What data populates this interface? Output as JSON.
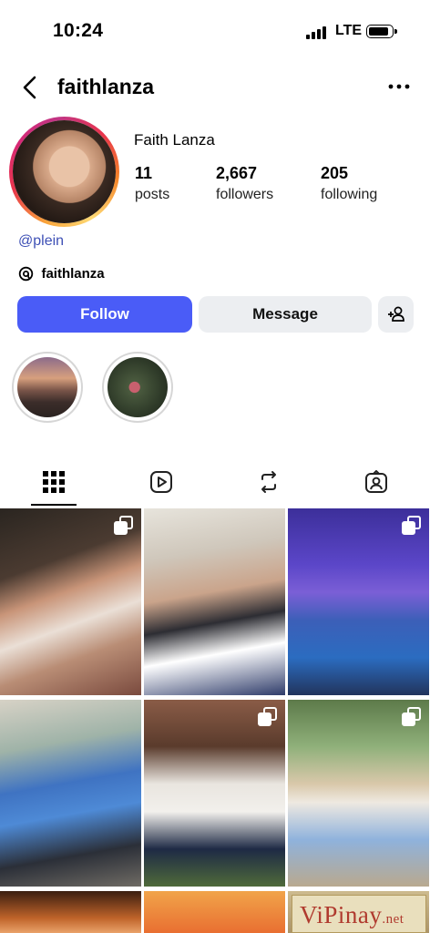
{
  "status_bar": {
    "time": "10:24",
    "network": "LTE"
  },
  "header": {
    "username": "faithlanza"
  },
  "profile": {
    "full_name": "Faith Lanza",
    "stats": [
      {
        "value": "11",
        "label": "posts"
      },
      {
        "value": "2,667",
        "label": "followers"
      },
      {
        "value": "205",
        "label": "following"
      }
    ],
    "link_text": "@plein",
    "threads_handle": "faithlanza"
  },
  "actions": {
    "follow_label": "Follow",
    "message_label": "Message"
  },
  "tabs": [
    "grid-icon",
    "reels-icon",
    "reposts-icon",
    "tagged-icon"
  ],
  "watermark": {
    "brand": "ViPinay",
    "suffix": ".net"
  },
  "colors": {
    "accent": "#4a5cf7",
    "link": "#3d4fb5",
    "button_secondary": "#eceef1"
  }
}
